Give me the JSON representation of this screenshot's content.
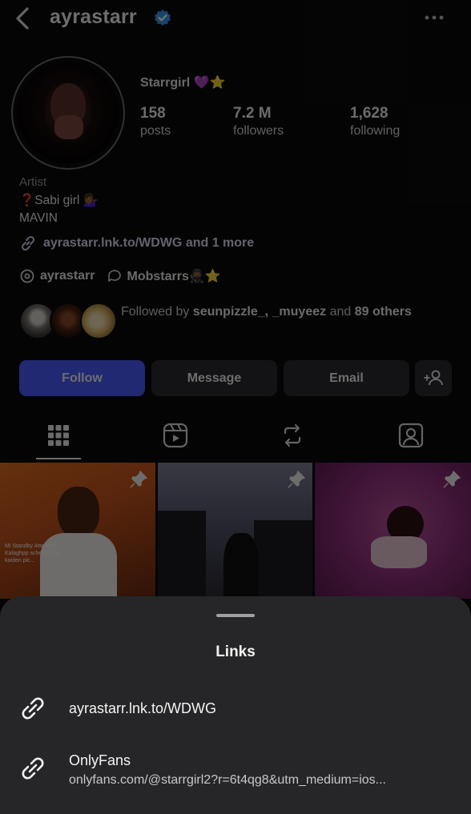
{
  "header": {
    "username": "ayrastarr",
    "back_icon": "chevron-left-icon",
    "verified_icon": "verified-badge-icon",
    "more_icon": "more-horizontal-icon"
  },
  "profile": {
    "display_name": "Starrgirl 💜⭐",
    "stats": [
      {
        "value": "158",
        "label": "posts"
      },
      {
        "value": "7.2 M",
        "label": "followers"
      },
      {
        "value": "1,628",
        "label": "following"
      }
    ],
    "category": "Artist",
    "bio_lines": [
      "❓Sabi girl 💁🏾‍♀️",
      "MAVIN"
    ],
    "link_text": "ayrastarr.lnk.to/WDWG and 1 more",
    "threads_handle": "ayrastarr",
    "broadcast_channel": "Mobstarrs🥷🏾⭐",
    "followed_by": {
      "prefix": "Followed by",
      "names": "seunpizzle_, _muyeez",
      "connector": "and",
      "count": "89",
      "suffix": "others"
    }
  },
  "actions": {
    "follow": "Follow",
    "message": "Message",
    "email": "Email",
    "add_person_icon": "add-person-icon"
  },
  "tabs": [
    "grid-icon",
    "reels-icon",
    "reposts-icon",
    "tagged-icon"
  ],
  "grid_caption": "Mi Standby Attendee Kalaghpp schedule Jul kaiden pic...",
  "sheet": {
    "title": "Links",
    "links": [
      {
        "main": "ayrastarr.lnk.to/WDWG",
        "sub": ""
      },
      {
        "main": "OnlyFans",
        "sub": "onlyfans.com/@starrgirl2?r=6t4qg8&utm_medium=ios..."
      }
    ]
  },
  "colors": {
    "follow_button": "#4a5cff",
    "sheet_bg": "#262628",
    "verified": "#3897f0"
  }
}
